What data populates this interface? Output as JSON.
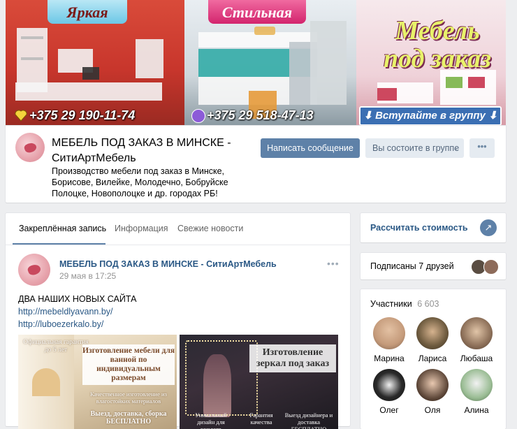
{
  "cover": {
    "tag_left": "Яркая",
    "tag_middle": "Стильная",
    "headline_line1": "Мебель",
    "headline_line2": "под заказ",
    "phone1": "+375 29 190-11-74",
    "phone2": "+375 29 518-47-13",
    "join_label": "Вступайте в группу"
  },
  "group": {
    "title": "МЕБЕЛЬ ПОД ЗАКАЗ В МИНСКЕ - СитиАртМебель",
    "description": "Производство мебели под заказ в Минске, Борисове, Вилейке, Молодечно, Бобруйске Полоцке, Новополоцке и др. городах РБ!",
    "message_button": "Написать сообщение",
    "member_button": "Вы состоите в группе",
    "more_button": "•••"
  },
  "tabs": [
    {
      "label": "Закреплённая запись"
    },
    {
      "label": "Информация"
    },
    {
      "label": "Свежие новости"
    }
  ],
  "post": {
    "author": "МЕБЕЛЬ ПОД ЗАКАЗ В МИНСКЕ - СитиАртМебель",
    "date": "29 мая в 17:25",
    "more": "•••",
    "text": "ДВА НАШИХ НОВЫХ САЙТА",
    "links": [
      "http://mebeldlyavann.by/",
      "http://luboezerkalo.by/"
    ],
    "photo1": {
      "guarantee": "Официальная гарантия до 5 лет",
      "banner": "Изготовление мебели для ванной по индивидуальным размерам",
      "note": "Качественное изготовление из влагостойких материалов",
      "footer": "Выезд, доставка, сборка БЕСПЛАТНО"
    },
    "photo2": {
      "banner": "Изготовление зеркал под заказ",
      "f1": "Уникальный дизайн для каждого",
      "f2": "Гарантия качества",
      "f3": "Выезд дизайнера и доставка БЕСПЛАТНО"
    }
  },
  "sidebar": {
    "calc_label": "Рассчитать стоимость",
    "calc_icon": "↗",
    "friends_label": "Подписаны 7 друзей",
    "members_label": "Участники",
    "members_count": "6 603",
    "members": [
      {
        "name": "Марина",
        "color": "#c49a7a"
      },
      {
        "name": "Лариса",
        "color": "#6d5a3e"
      },
      {
        "name": "Любаша",
        "color": "#8d7059"
      },
      {
        "name": "Олег",
        "color": "#2a2a2a"
      },
      {
        "name": "Оля",
        "color": "#5a4436"
      },
      {
        "name": "Алина",
        "color": "#9bbd95"
      }
    ]
  },
  "colors": {
    "accent": "#5e81a8",
    "link": "#2a5885",
    "background": "#edeef0"
  }
}
